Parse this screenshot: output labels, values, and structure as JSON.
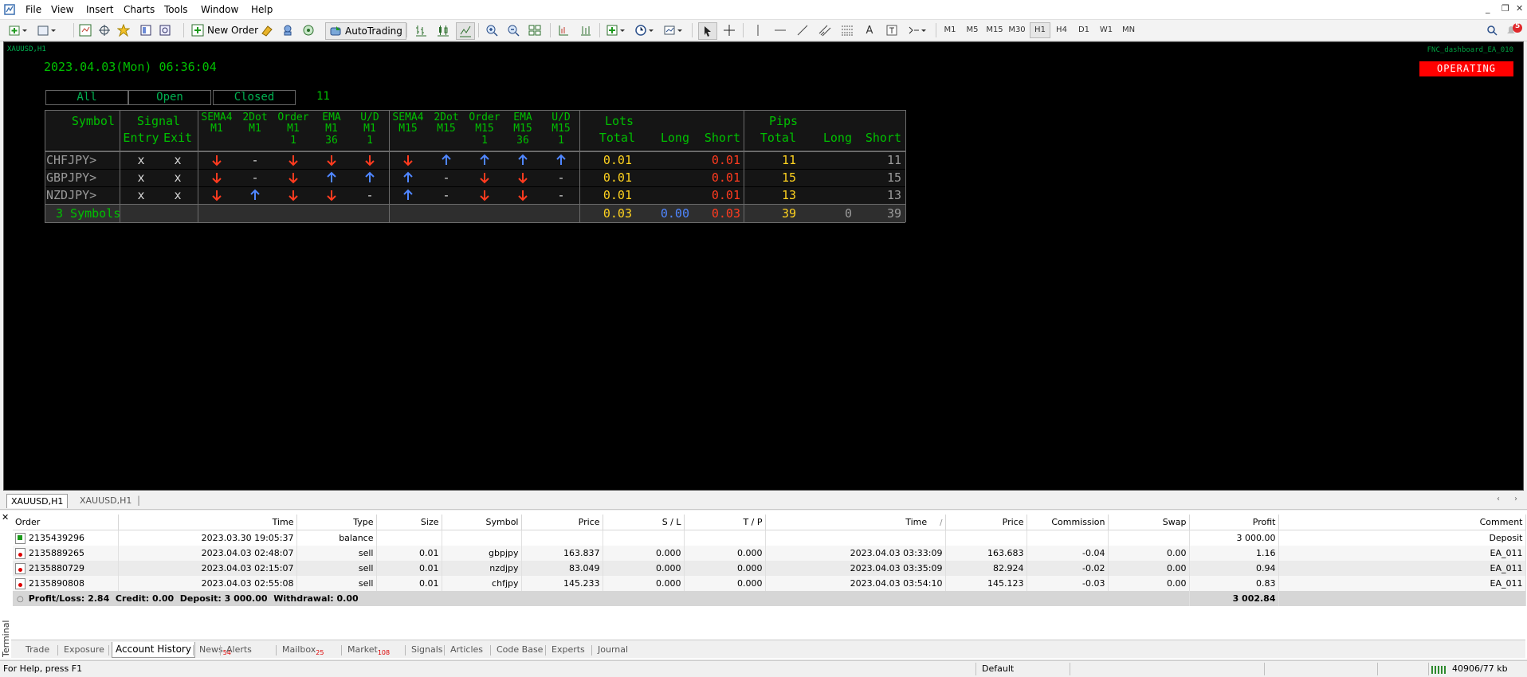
{
  "menu": [
    "File",
    "View",
    "Insert",
    "Charts",
    "Tools",
    "Window",
    "Help"
  ],
  "toolbar": {
    "new_order": "New Order",
    "autotrading": "AutoTrading",
    "timeframes": [
      "M1",
      "M5",
      "M15",
      "M30",
      "H1",
      "H4",
      "D1",
      "W1",
      "MN"
    ],
    "selected_timeframe": "H1",
    "notification_badge": "5"
  },
  "chart": {
    "symbol_label": "XAUUSD,H1",
    "datetime": "2023.04.03(Mon) 06:36:04",
    "ea_name": "FNC_dashboard_EA_010",
    "status": "OPERATING",
    "filters": [
      "All",
      "Open",
      "Closed"
    ],
    "count": "11"
  },
  "dashboard": {
    "headers": {
      "symbol": "Symbol",
      "signal": "Signal",
      "entry": "Entry",
      "exit": "Exit",
      "lots": "Lots",
      "pips": "Pips",
      "total": "Total",
      "long": "Long",
      "short": "Short",
      "indicators": [
        [
          "SEMA4",
          "M1",
          ""
        ],
        [
          "2Dot",
          "M1",
          ""
        ],
        [
          "Order",
          "M1",
          "1"
        ],
        [
          "EMA",
          "M1",
          "36"
        ],
        [
          "U/D",
          "M1",
          "1"
        ],
        [
          "SEMA4",
          "M15",
          ""
        ],
        [
          "2Dot",
          "M15",
          ""
        ],
        [
          "Order",
          "M15",
          "1"
        ],
        [
          "EMA",
          "M15",
          "36"
        ],
        [
          "U/D",
          "M15",
          "1"
        ]
      ]
    },
    "rows": [
      {
        "symbol": "CHFJPY>",
        "entry": "x",
        "exit": "x",
        "signals": [
          "down",
          "-",
          "down",
          "down",
          "down",
          "down",
          "up",
          "up",
          "up",
          "up"
        ],
        "lots_total": "0.01",
        "lots_long": "",
        "lots_short": "0.01",
        "pips_total": "11",
        "pips_long": "",
        "pips_short": "11"
      },
      {
        "symbol": "GBPJPY>",
        "entry": "x",
        "exit": "x",
        "signals": [
          "down",
          "-",
          "down",
          "up",
          "up",
          "up",
          "-",
          "down",
          "down",
          "-"
        ],
        "lots_total": "0.01",
        "lots_long": "",
        "lots_short": "0.01",
        "pips_total": "15",
        "pips_long": "",
        "pips_short": "15"
      },
      {
        "symbol": "NZDJPY>",
        "entry": "x",
        "exit": "x",
        "signals": [
          "down",
          "up",
          "down",
          "down",
          "-",
          "up",
          "-",
          "down",
          "down",
          "-"
        ],
        "lots_total": "0.01",
        "lots_long": "",
        "lots_short": "0.01",
        "pips_total": "13",
        "pips_long": "",
        "pips_short": "13"
      }
    ],
    "totals": {
      "label": "3 Symbols",
      "lots_total": "0.03",
      "lots_long": "0.00",
      "lots_short": "0.03",
      "pips_total": "39",
      "pips_long": "0",
      "pips_short": "39"
    }
  },
  "chart_tabs": [
    "XAUUSD,H1",
    "XAUUSD,H1"
  ],
  "history": {
    "columns": [
      "Order",
      "Time",
      "Type",
      "Size",
      "Symbol",
      "Price",
      "S / L",
      "T / P",
      "Time",
      "Price",
      "Commission",
      "Swap",
      "Profit",
      "Comment"
    ],
    "sort_indicator": "/",
    "rows": [
      {
        "order": "2135439296",
        "time": "2023.03.30 19:05:37",
        "type": "balance",
        "size": "",
        "symbol": "",
        "price": "",
        "sl": "",
        "tp": "",
        "close_time": "",
        "close_price": "",
        "commission": "",
        "swap": "",
        "profit": "3 000.00",
        "comment": "Deposit"
      },
      {
        "order": "2135889265",
        "time": "2023.04.03 02:48:07",
        "type": "sell",
        "size": "0.01",
        "symbol": "gbpjpy",
        "price": "163.837",
        "sl": "0.000",
        "tp": "0.000",
        "close_time": "2023.04.03 03:33:09",
        "close_price": "163.683",
        "commission": "-0.04",
        "swap": "0.00",
        "profit": "1.16",
        "comment": "EA_011"
      },
      {
        "order": "2135880729",
        "time": "2023.04.03 02:15:07",
        "type": "sell",
        "size": "0.01",
        "symbol": "nzdjpy",
        "price": "83.049",
        "sl": "0.000",
        "tp": "0.000",
        "close_time": "2023.04.03 03:35:09",
        "close_price": "82.924",
        "commission": "-0.02",
        "swap": "0.00",
        "profit": "0.94",
        "comment": "EA_011"
      },
      {
        "order": "2135890808",
        "time": "2023.04.03 02:55:08",
        "type": "sell",
        "size": "0.01",
        "symbol": "chfjpy",
        "price": "145.233",
        "sl": "0.000",
        "tp": "0.000",
        "close_time": "2023.04.03 03:54:10",
        "close_price": "145.123",
        "commission": "-0.03",
        "swap": "0.00",
        "profit": "0.83",
        "comment": "EA_011"
      }
    ],
    "summary": "Profit/Loss: 2.84  Credit: 0.00  Deposit: 3 000.00  Withdrawal: 0.00",
    "summary_total": "3 002.84"
  },
  "terminal_label": "Terminal",
  "bottom_tabs": [
    {
      "label": "Trade",
      "badge": ""
    },
    {
      "label": "Exposure",
      "badge": ""
    },
    {
      "label": "Account History",
      "badge": ""
    },
    {
      "label": "News",
      "badge": "54"
    },
    {
      "label": "Alerts",
      "badge": ""
    },
    {
      "label": "Mailbox",
      "badge": "25"
    },
    {
      "label": "Market",
      "badge": "108"
    },
    {
      "label": "Signals",
      "badge": ""
    },
    {
      "label": "Articles",
      "badge": ""
    },
    {
      "label": "Code Base",
      "badge": ""
    },
    {
      "label": "Experts",
      "badge": ""
    },
    {
      "label": "Journal",
      "badge": ""
    }
  ],
  "status": {
    "help": "For Help, press F1",
    "profile": "Default",
    "traffic": "40906/77 kb"
  },
  "colors": {
    "green": "#00c000",
    "yellow": "#ffd21f",
    "red": "#ff3b1f",
    "blue": "#4f86ff",
    "grey": "#9a9a9a",
    "operating": "#ff0000"
  }
}
